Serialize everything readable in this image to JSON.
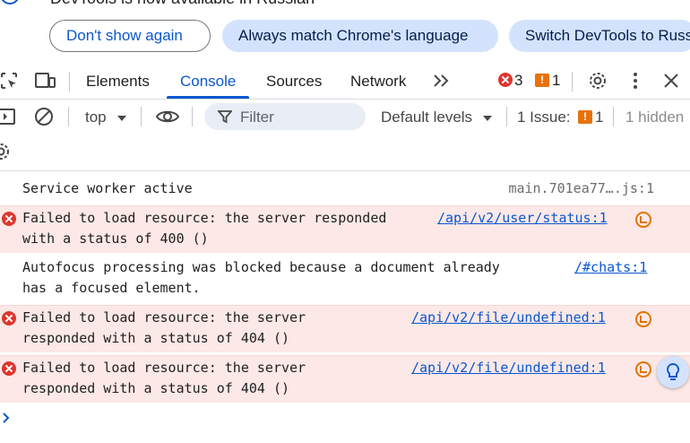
{
  "infobar": {
    "message": "DevTools is now available in Russian",
    "buttons": [
      "Don't show again",
      "Always match Chrome's language",
      "Switch DevTools to Russian"
    ]
  },
  "toolbar": {
    "tabs": [
      "Elements",
      "Console",
      "Sources",
      "Network"
    ],
    "active_tab": "Console",
    "error_count": "3",
    "warning_count": "1"
  },
  "console_bar": {
    "context": "top",
    "filter_placeholder": "Filter",
    "levels": "Default levels",
    "issues_label": "1 Issue:",
    "issues_count": "1",
    "hidden_label": "1 hidden"
  },
  "messages": [
    {
      "level": "info",
      "text": "Service worker active",
      "source": "main.701ea77….js:1"
    },
    {
      "level": "error",
      "text": "Failed to load resource: the server responded\nwith a status of 400 ()",
      "source": "/api/v2/user/status:1"
    },
    {
      "level": "info",
      "text": "Autofocus processing was blocked because a document already\nhas a focused element.",
      "source": "/#chats:1"
    },
    {
      "level": "error",
      "text": "Failed to load resource: the server\nresponded with a status of 404 ()",
      "source": "/api/v2/file/undefined:1"
    },
    {
      "level": "error",
      "text": "Failed to load resource: the server\nresponded with a status of 404 ()",
      "source": "/api/v2/file/undefined:1"
    }
  ],
  "colors": {
    "accent": "#0b57d0",
    "error": "#dc362e",
    "error_bg": "#fce8e6",
    "warning": "#e8710a"
  }
}
